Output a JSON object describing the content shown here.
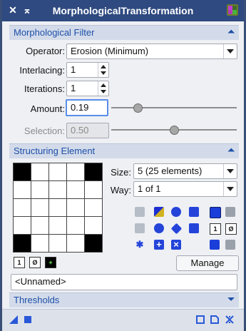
{
  "window": {
    "title": "MorphologicalTransformation"
  },
  "morph_section": {
    "label": "Morphological Filter"
  },
  "operator": {
    "label": "Operator:",
    "value": "Erosion (Minimum)"
  },
  "interlacing": {
    "label": "Interlacing:",
    "value": "1"
  },
  "iterations": {
    "label": "Iterations:",
    "value": "1"
  },
  "amount": {
    "label": "Amount:",
    "value": "0.19",
    "slider_level": 0.19
  },
  "selection": {
    "label": "Selection:",
    "value": "0.50",
    "slider_level": 0.5
  },
  "struct_section": {
    "label": "Structuring Element"
  },
  "size": {
    "label": "Size:",
    "value": "5  (25 elements)"
  },
  "way": {
    "label": "Way:",
    "value": "1 of 1"
  },
  "element_grid": [
    [
      1,
      0,
      0,
      0,
      1
    ],
    [
      0,
      0,
      0,
      0,
      0
    ],
    [
      0,
      0,
      0,
      0,
      0
    ],
    [
      0,
      0,
      0,
      0,
      0
    ],
    [
      1,
      0,
      0,
      0,
      1
    ]
  ],
  "element_buttons": {
    "one": "1",
    "zero": "Ø"
  },
  "manage_button": "Manage",
  "element_name": "<Unnamed>",
  "thresholds_section": {
    "label": "Thresholds"
  },
  "colors": {
    "titlebar": "#2f4a80",
    "section": "#d3dbea",
    "accent": "#1d4fa8"
  }
}
